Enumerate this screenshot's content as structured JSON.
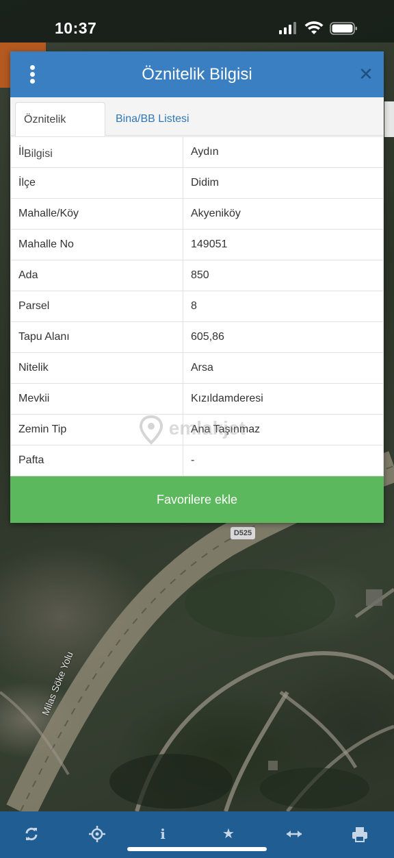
{
  "status_bar": {
    "time": "10:37"
  },
  "modal": {
    "title": "Öznitelik Bilgisi",
    "tabs": [
      {
        "label": "Öznitelik Bilgisi",
        "active": true
      },
      {
        "label": "Bina/BB Listesi",
        "active": false
      }
    ],
    "rows": [
      {
        "key": "İl",
        "value": "Aydın"
      },
      {
        "key": "İlçe",
        "value": "Didim"
      },
      {
        "key": "Mahalle/Köy",
        "value": "Akyeniköy"
      },
      {
        "key": "Mahalle No",
        "value": "149051"
      },
      {
        "key": "Ada",
        "value": "850"
      },
      {
        "key": "Parsel",
        "value": "8"
      },
      {
        "key": "Tapu Alanı",
        "value": "605,86"
      },
      {
        "key": "Nitelik",
        "value": "Arsa"
      },
      {
        "key": "Mevkii",
        "value": "Kızıldamderesi"
      },
      {
        "key": "Zemin Tip",
        "value": "Ana Taşınmaz"
      },
      {
        "key": "Pafta",
        "value": "-"
      }
    ],
    "favorite_button": "Favorilere ekle"
  },
  "map": {
    "road_badge": "D525",
    "road_name": "Milas Söke Yolu"
  },
  "watermark": "emlakjet",
  "toolbar": {
    "items": [
      "refresh-icon",
      "locate-icon",
      "info-icon",
      "star-icon",
      "measure-icon",
      "print-icon"
    ]
  },
  "colors": {
    "header": "#3a7fc1",
    "tab_link": "#2f77b5",
    "button": "#5cb85c",
    "toolbar": "#1f5d93"
  }
}
